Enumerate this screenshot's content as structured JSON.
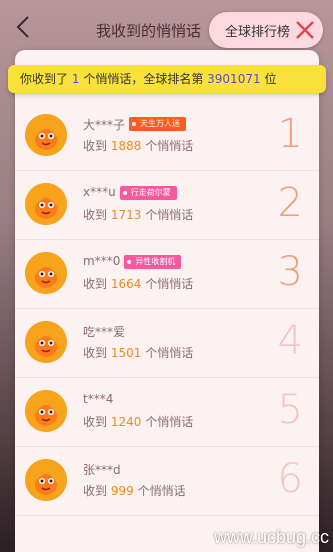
{
  "header": {
    "title": "我收到的悄悄话"
  },
  "rank_button": {
    "label": "全球排行榜"
  },
  "summary": {
    "prefix": "你收到了",
    "count": "1",
    "middle": "个悄悄话，全球排名第",
    "rank": "3901071",
    "suffix": "位"
  },
  "list": [
    {
      "name": "大***子",
      "tag": "天生万人迷",
      "tag_color": "#ff5a1f",
      "received_prefix": "收到",
      "count": "1888",
      "received_suffix": "个悄悄话",
      "rank": "1",
      "rank_color": "#f0a07a"
    },
    {
      "name": "x***u",
      "tag": "行走荷尔蒙",
      "tag_color": "#f55a9c",
      "received_prefix": "收到",
      "count": "1713",
      "received_suffix": "个悄悄话",
      "rank": "2",
      "rank_color": "#f0a07a"
    },
    {
      "name": "m***0",
      "tag": "异性收割机",
      "tag_color": "#f55a9c",
      "received_prefix": "收到",
      "count": "1664",
      "received_suffix": "个悄悄话",
      "rank": "3",
      "rank_color": "#f0a07a"
    },
    {
      "name": "吃***爱",
      "tag": "",
      "received_prefix": "收到",
      "count": "1501",
      "received_suffix": "个悄悄话",
      "rank": "4",
      "rank_color": "#f3c4c6"
    },
    {
      "name": "t***4",
      "tag": "",
      "received_prefix": "收到",
      "count": "1240",
      "received_suffix": "个悄悄话",
      "rank": "5",
      "rank_color": "#f3c4c6"
    },
    {
      "name": "张***d",
      "tag": "",
      "received_prefix": "收到",
      "count": "999",
      "received_suffix": "个悄悄话",
      "rank": "6",
      "rank_color": "#f3c4c6"
    }
  ],
  "watermark": "www.ucbug.cc",
  "colors": {
    "summary_bg": "#f9e13c",
    "highlight": "#5b4bd3",
    "count_accent": "#f08a1c",
    "avatar": "#f8a31c",
    "close": "#e4424f"
  },
  "icons": {
    "back": "back-arrow-icon",
    "close": "close-icon",
    "avatar": "mascot-avatar-icon"
  }
}
